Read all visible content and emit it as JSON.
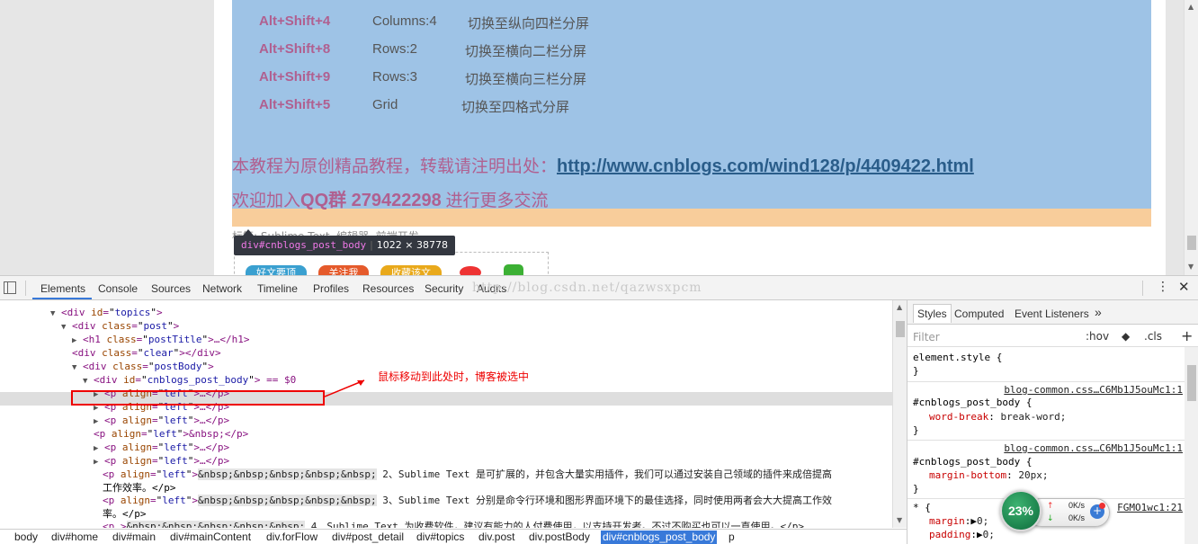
{
  "page": {
    "shortcuts": [
      {
        "keys": "Alt+Shift+4",
        "layout": "Columns:4",
        "desc": "切换至纵向四栏分屏"
      },
      {
        "keys": "Alt+Shift+8",
        "layout": "Rows:2",
        "desc": "切换至横向二栏分屏"
      },
      {
        "keys": "Alt+Shift+9",
        "layout": "Rows:3",
        "desc": "切换至横向三栏分屏"
      },
      {
        "keys": "Alt+Shift+5",
        "layout": "Grid",
        "desc": "切换至四格式分屏"
      }
    ],
    "notice_prefix": "本教程为原创精品教程，转载请注明出处：",
    "notice_link": "http://www.cnblogs.com/wind128/p/4409422.html",
    "welcome_prefix": "欢迎加入",
    "welcome_group": "QQ群 279422298",
    "welcome_suffix": " 进行更多交流",
    "tags": "标签: Sublime Text, 编辑器, 前端开发",
    "tooltip_tag": "div#cnblogs_post_body",
    "tooltip_size": "1022 × 38778",
    "share_buttons": [
      "好文要顶",
      "关注我",
      "收藏该文"
    ]
  },
  "devtools": {
    "tabs": [
      "Elements",
      "Console",
      "Sources",
      "Network",
      "Timeline",
      "Profiles",
      "Resources",
      "Security",
      "Audits"
    ],
    "active_tab": "Elements",
    "watermark": "http://blog.csdn.net/qazwsxpcm",
    "annotation": "鼠标移动到此处时，博客被选中",
    "tree": [
      {
        "indent": 56,
        "tri": "▼",
        "tag": "div",
        "attr": "id",
        "val": "topics",
        "end": ">"
      },
      {
        "indent": 68,
        "tri": "▼",
        "tag": "div",
        "attr": "class",
        "val": "post",
        "end": ">"
      },
      {
        "indent": 80,
        "tri": "▶",
        "tag": "h1",
        "attr": "class",
        "val": "postTitle",
        "end": ">…</h1>"
      },
      {
        "indent": 80,
        "tri": "",
        "tag": "div",
        "attr": "class",
        "val": "clear",
        "end": "></div>"
      },
      {
        "indent": 80,
        "tri": "▼",
        "tag": "div",
        "attr": "class",
        "val": "postBody",
        "end": ">"
      },
      {
        "indent": 92,
        "tri": "▼",
        "tag": "div",
        "attr": "id",
        "val": "cnblogs_post_body",
        "end": "> == $0"
      },
      {
        "indent": 104,
        "tri": "▶",
        "tag": "p",
        "attr": "align",
        "val": "left",
        "end": ">…</p>"
      },
      {
        "indent": 104,
        "tri": "▶",
        "tag": "p",
        "attr": "align",
        "val": "left",
        "end": ">…</p>"
      },
      {
        "indent": 104,
        "tri": "▶",
        "tag": "p",
        "attr": "align",
        "val": "left",
        "end": ">…</p>"
      },
      {
        "indent": 104,
        "tri": "",
        "tag": "p",
        "attr": "align",
        "val": "left",
        "end": ">&nbsp;</p>"
      },
      {
        "indent": 104,
        "tri": "▶",
        "tag": "p",
        "attr": "align",
        "val": "left",
        "end": ">…</p>"
      },
      {
        "indent": 104,
        "tri": "▶",
        "tag": "p",
        "attr": "align",
        "val": "left",
        "end": ">…</p>"
      }
    ],
    "text_rows": [
      {
        "ent": "&nbsp;&nbsp;&nbsp;&nbsp;&nbsp;",
        "text": " 2、Sublime Text 是可扩展的，并包含大量实用插件，我们可以通过安装自己领域的插件来成倍提高",
        "cont": "工作效率。</p>"
      },
      {
        "ent": "&nbsp;&nbsp;&nbsp;&nbsp;&nbsp;",
        "text": " 3、Sublime Text 分别是命令行环境和图形界面环境下的最佳选择，同时使用两者会大大提高工作效",
        "cont": "率。</p>"
      },
      {
        "ent": "&nbsp;&nbsp;&nbsp;&nbsp;&nbsp;",
        "text": " 4、Sublime Text 为收费软件，建议有能力的人付费使用，以支持开发者。不过不购买也可以一直使用。</p>"
      }
    ],
    "breadcrumbs": [
      "body",
      "div#home",
      "div#main",
      "div#mainContent",
      "div.forFlow",
      "div#post_detail",
      "div#topics",
      "div.post",
      "div.postBody",
      "div#cnblogs_post_body",
      "p"
    ],
    "selected_crumb": "div#cnblogs_post_body",
    "styles": {
      "tabs": [
        "Styles",
        "Computed",
        "Event Listeners"
      ],
      "filter_placeholder": "Filter",
      "hov": ":hov",
      "cls": ".cls",
      "element_style": "element.style {",
      "rule1_src": "blog-common.css…C6Mb1J5ouMc1:1",
      "rule1_sel": "#cnblogs_post_body {",
      "rule1_prop": "word-break",
      "rule1_val": "break-word;",
      "rule2_src": "blog-common.css…C6Mb1J5ouMc1:1",
      "rule2_sel": "#cnblogs_post_body {",
      "rule2_prop": "margin-bottom",
      "rule2_val": "20px;",
      "rule3_src": "FGMO1wc1:21",
      "rule3_sel": "* {",
      "rule3_prop1": "margin",
      "rule3_val1": "0;",
      "rule3_prop2": "padding",
      "rule3_val2": "0;",
      "close_brace": "}"
    }
  },
  "widget": {
    "percent": "23%",
    "up_speed": "0K/s",
    "down_speed": "0K/s"
  }
}
